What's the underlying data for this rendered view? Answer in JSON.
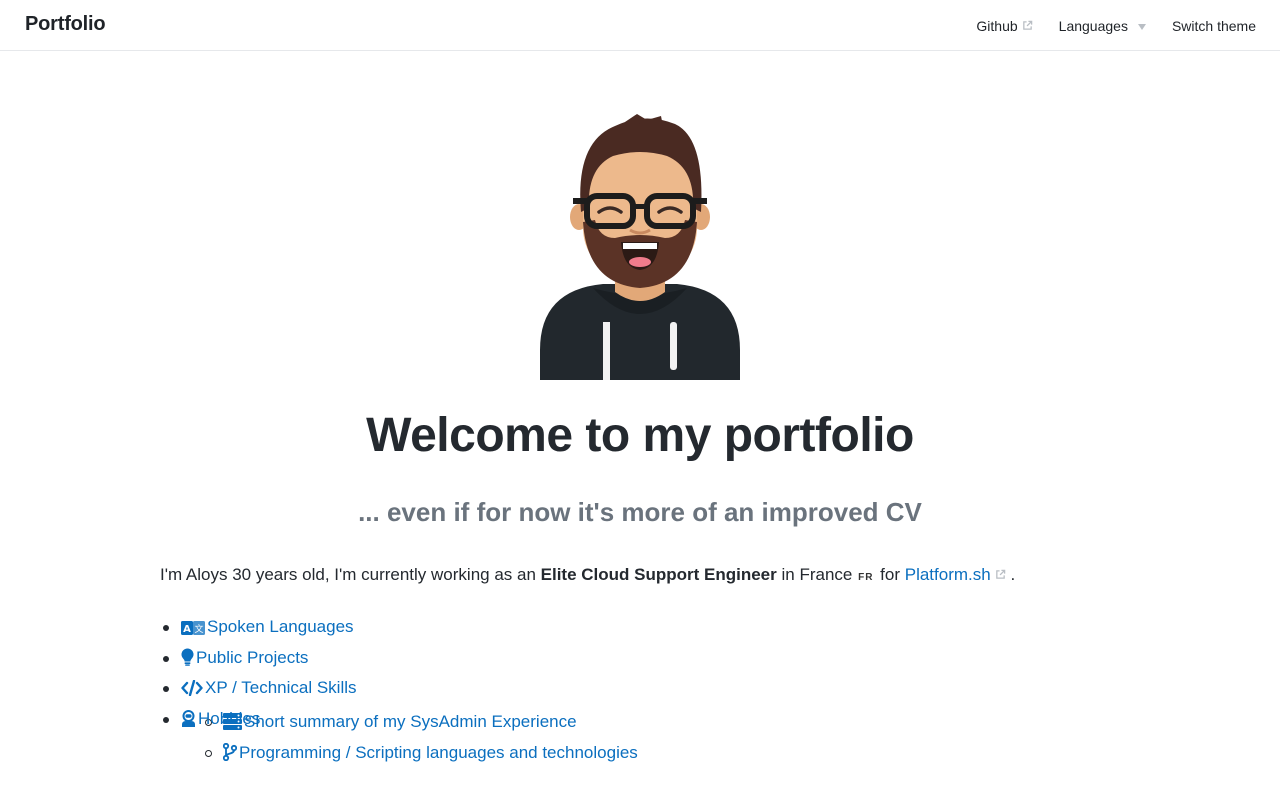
{
  "header": {
    "brand": "Portfolio",
    "nav": {
      "github": "Github",
      "languages": "Languages",
      "switch_theme": "Switch theme"
    }
  },
  "hero": {
    "title": "Welcome to my portfolio",
    "subtitle": "... even if for now it's more of an improved CV"
  },
  "intro": {
    "prefix": "I'm Aloys 30 years old, I'm currently working as an ",
    "role": "Elite Cloud Support Engineer",
    "location": " in France",
    "flag": "FR",
    "for": " for ",
    "company": "Platform.sh",
    "suffix": " ."
  },
  "toc": {
    "spoken_languages": "Spoken Languages",
    "public_projects": "Public Projects",
    "xp": "XP / Technical Skills",
    "sysadmin": "Short summary of my SysAdmin Experience",
    "programming": "Programming / Scripting languages and technologies",
    "hobbies": "Hobbies"
  },
  "icons": {
    "language": "language-icon",
    "lightbulb": "lightbulb-icon",
    "code": "code-icon",
    "server": "server-icon",
    "branch": "code-branch-icon",
    "user": "user-astronaut-icon",
    "external": "external-link-icon"
  },
  "colors": {
    "link": "#0b6fbf",
    "text": "#24292f",
    "muted": "#6a737d"
  }
}
